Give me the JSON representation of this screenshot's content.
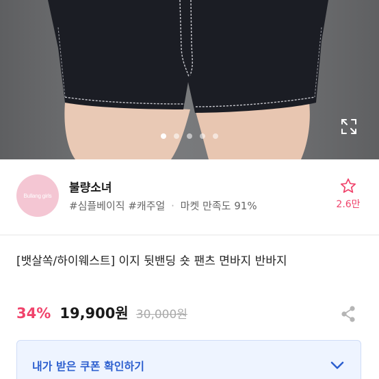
{
  "gallery": {
    "slide_count": 5,
    "active_index": 0,
    "icon": "expand-icon"
  },
  "store": {
    "logo_text": "Bullang girls",
    "name": "불량소녀",
    "tags": [
      "#심플베이직",
      "#캐주얼"
    ],
    "satisfaction_label": "마켓 만족도",
    "satisfaction_value": "91%",
    "favorite_count": "2.6만",
    "favorite_icon": "star-outline-icon",
    "accent_color": "#f0436b",
    "logo_color": "#f4c6d3"
  },
  "product": {
    "title": "[뱃살쏙/하이웨스트] 이지 뒷밴딩 숏 팬츠 면바지 반바지",
    "discount": "34%",
    "price": "19,900원",
    "original_price": "30,000원",
    "share_icon": "share-icon"
  },
  "coupon": {
    "label": "내가 받은 쿠폰 확인하기",
    "icon": "chevron-down-icon",
    "accent_color": "#2d5fcf"
  }
}
